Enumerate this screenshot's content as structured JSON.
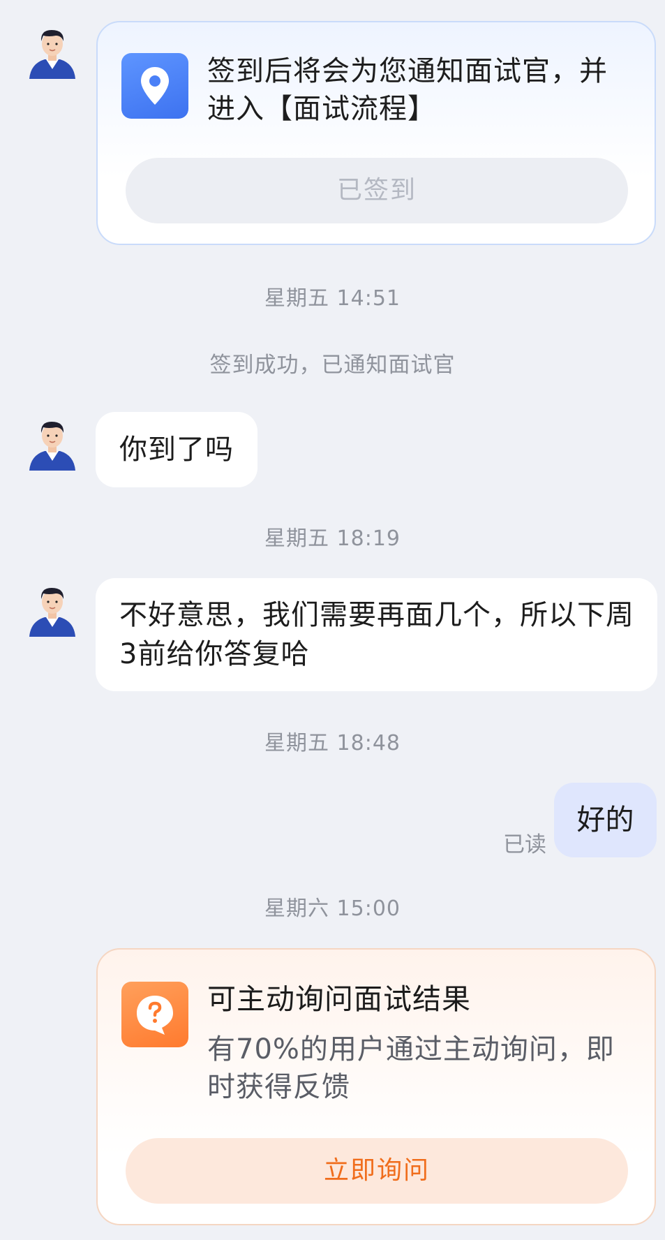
{
  "checkin_card": {
    "text": "签到后将会为您通知面试官，并进入【面试流程】",
    "button_label": "已签到",
    "icon": "location-pin-icon"
  },
  "timestamps": {
    "t1": "星期五 14:51",
    "t2": "星期五 18:19",
    "t3": "星期五 18:48",
    "t4": "星期六 15:00"
  },
  "system_message": "签到成功，已通知面试官",
  "messages": {
    "incoming_1": "你到了吗",
    "incoming_2": "不好意思，我们需要再面几个，所以下周3前给你答复哈",
    "outgoing_1": "好的",
    "outgoing_1_status": "已读"
  },
  "inquiry_card": {
    "title": "可主动询问面试结果",
    "description": "有70%的用户通过主动询问，即时获得反馈",
    "button_label": "立即询问",
    "icon": "question-bubble-icon"
  },
  "colors": {
    "background": "#eff1f6",
    "checkin_accent": "#4a80f7",
    "inquiry_accent": "#f06d1c",
    "outgoing_bubble": "#dfe6fd"
  }
}
